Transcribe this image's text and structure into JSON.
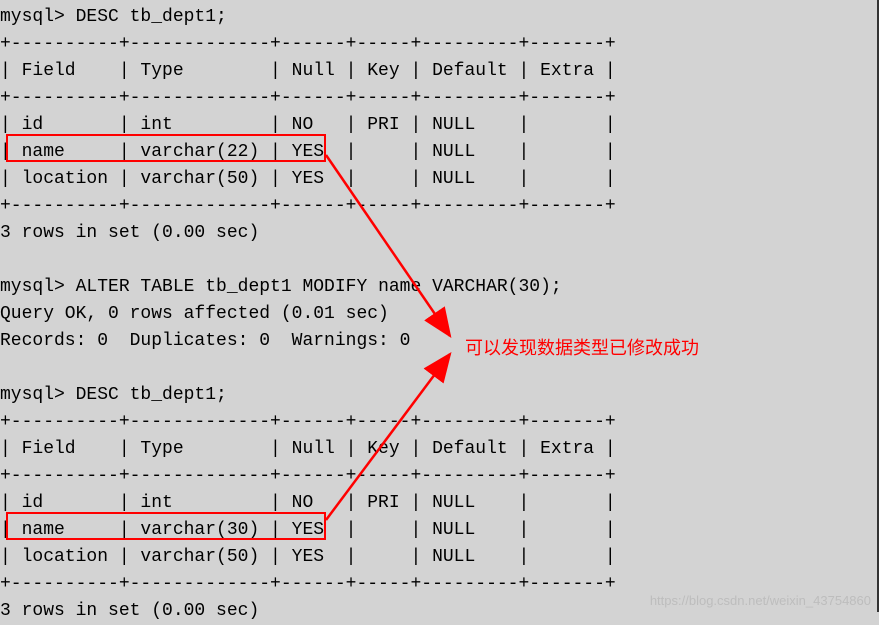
{
  "prompt": "mysql>",
  "cmd_desc1": " DESC tb_dept1;",
  "cmd_alter": " ALTER TABLE tb_dept1 MODIFY name VARCHAR(30);",
  "query_ok": "Query OK, 0 rows affected (0.01 sec)",
  "records_line": "Records: 0  Duplicates: 0  Warnings: 0",
  "cmd_desc2": " DESC tb_dept1;",
  "rows_summary": "3 rows in set (0.00 sec)",
  "table1": {
    "sep": "+----------+-------------+------+-----+---------+-------+",
    "header": "| Field    | Type        | Null | Key | Default | Extra |",
    "row1": "| id       | int         | NO   | PRI | NULL    |       |",
    "row2": "| name     | varchar(22) | YES  |     | NULL    |       |",
    "row3": "| location | varchar(50) | YES  |     | NULL    |       |"
  },
  "table2": {
    "sep": "+----------+-------------+------+-----+---------+-------+",
    "header": "| Field    | Type        | Null | Key | Default | Extra |",
    "row1": "| id       | int         | NO   | PRI | NULL    |       |",
    "row2": "| name     | varchar(30) | YES  |     | NULL    |       |",
    "row3": "| location | varchar(50) | YES  |     | NULL    |       |"
  },
  "annotation_text": "可以发现数据类型已修改成功",
  "watermark": "https://blog.csdn.net/weixin_43754860"
}
